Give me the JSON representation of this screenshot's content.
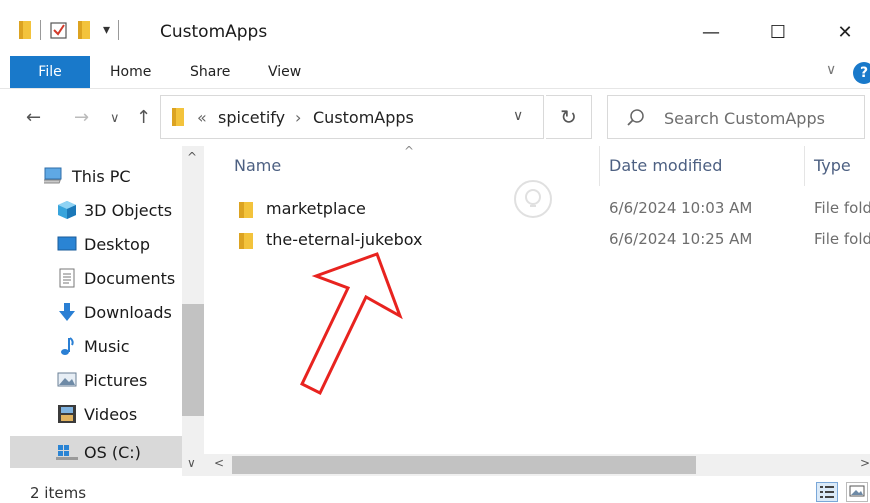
{
  "window": {
    "title": "CustomApps",
    "minimize_symbol": "—",
    "maximize_symbol": "☐",
    "close_symbol": "✕",
    "quick_access_dropdown": "▾"
  },
  "ribbon": {
    "tabs": [
      {
        "label": "File"
      },
      {
        "label": "Home"
      },
      {
        "label": "Share"
      },
      {
        "label": "View"
      }
    ],
    "expand_symbol": "∨",
    "help_symbol": "?"
  },
  "address": {
    "back_symbol": "←",
    "forward_symbol": "→",
    "recent_symbol": "∨",
    "up_symbol": "↑",
    "overflow": "«",
    "separator": "›",
    "breadcrumbs": [
      {
        "label": "spicetify"
      },
      {
        "label": "CustomApps"
      }
    ],
    "dropdown_symbol": "∨",
    "refresh_symbol": "↻"
  },
  "search": {
    "placeholder": "Search CustomApps"
  },
  "nav_pane": {
    "items": [
      {
        "label": "This PC",
        "icon": "computer-icon"
      },
      {
        "label": "3D Objects",
        "icon": "cube-icon"
      },
      {
        "label": "Desktop",
        "icon": "desktop-icon"
      },
      {
        "label": "Documents",
        "icon": "document-icon"
      },
      {
        "label": "Downloads",
        "icon": "download-icon"
      },
      {
        "label": "Music",
        "icon": "music-icon"
      },
      {
        "label": "Pictures",
        "icon": "picture-icon"
      },
      {
        "label": "Videos",
        "icon": "film-icon"
      },
      {
        "label": "OS (C:)",
        "icon": "drive-icon",
        "selected": true
      }
    ],
    "scroll_up_symbol": "^",
    "scroll_down_symbol": "∨"
  },
  "file_list": {
    "columns": {
      "name": "Name",
      "date": "Date modified",
      "type": "Type"
    },
    "sort_symbol": "^",
    "rows": [
      {
        "name": "marketplace",
        "date": "6/6/2024 10:03 AM",
        "type": "File fold"
      },
      {
        "name": "the-eternal-jukebox",
        "date": "6/6/2024 10:25 AM",
        "type": "File fold"
      }
    ]
  },
  "hscroll": {
    "left_symbol": "<",
    "right_symbol": ">"
  },
  "status": {
    "item_count": "2 items"
  },
  "colors": {
    "accent": "#1979ca",
    "annotation_arrow": "#e8231f",
    "selection": "#d9d9d9",
    "folder": "#f3c33c"
  }
}
